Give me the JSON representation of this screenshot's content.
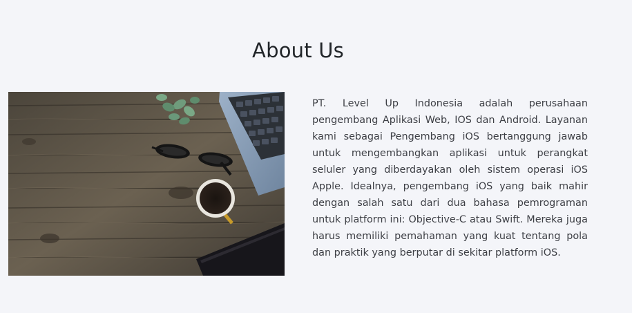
{
  "section": {
    "title": "About Us",
    "image_description_icon": "desk-workspace-photo",
    "paragraph": "PT. Level Up Indonesia adalah perusahaan pengembang Aplikasi Web, IOS dan Android. Layanan kami sebagai Pengembang iOS bertanggung jawab untuk mengembangkan aplikasi untuk perangkat seluler yang diberdayakan oleh sistem operasi iOS Apple. Idealnya, pengembang iOS yang baik mahir dengan salah satu dari dua bahasa pemrograman untuk platform ini: Objective-C atau Swift. Mereka juga harus memiliki pemahaman yang kuat tentang pola dan praktik yang berputar di sekitar platform iOS."
  },
  "colors": {
    "background": "#f4f5f9",
    "title": "#212529",
    "text": "#3d3f45",
    "wood": "#5a5246"
  }
}
